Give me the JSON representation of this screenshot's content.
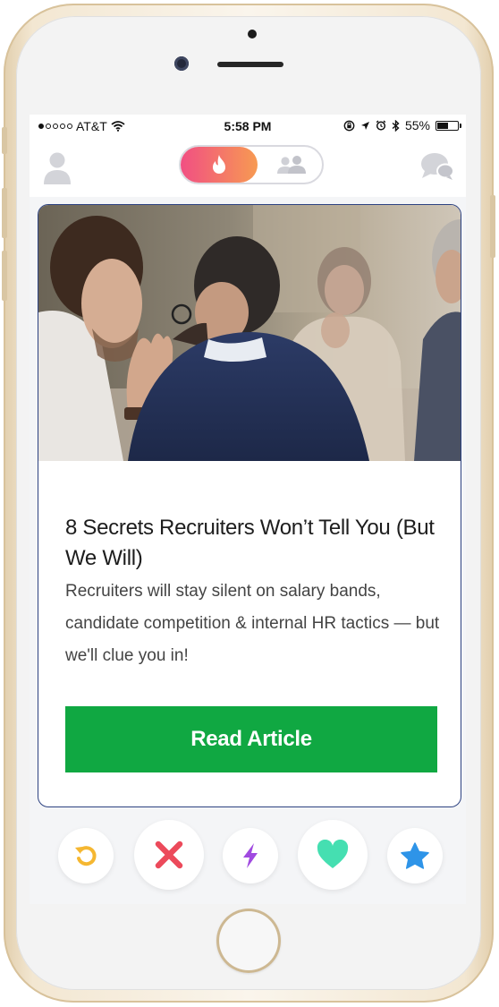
{
  "status_bar": {
    "carrier": "AT&T",
    "time": "5:58 PM",
    "battery_percent": "55%",
    "battery_level": 0.55,
    "signal_filled_dots": 1,
    "signal_total_dots": 5
  },
  "top_nav": {
    "left_icon": "profile-icon",
    "toggle_active_icon": "flame-icon",
    "toggle_inactive_icon": "group-icon",
    "right_icon": "chat-icon",
    "toggle_gradient": [
      "#f14f83",
      "#f79a52"
    ]
  },
  "card": {
    "image_icon": "photo",
    "title": "8 Secrets Recruiters Won’t Tell You (But We Will)",
    "description": "Recruiters will stay silent on salary bands, candidate competition & internal HR tactics — but we'll clue you in!",
    "button_label": "Read Article",
    "button_color": "#10a842",
    "border_color": "#2d4281"
  },
  "actions": [
    {
      "name": "rewind",
      "icon": "rewind-icon",
      "color": "#f5b731"
    },
    {
      "name": "nope",
      "icon": "close-icon",
      "color": "#ec4a5b"
    },
    {
      "name": "boost",
      "icon": "lightning-icon",
      "color": "#a04ae0"
    },
    {
      "name": "like",
      "icon": "heart-icon",
      "color": "#45dfb1"
    },
    {
      "name": "super-like",
      "icon": "star-icon",
      "color": "#2e94e8"
    }
  ]
}
